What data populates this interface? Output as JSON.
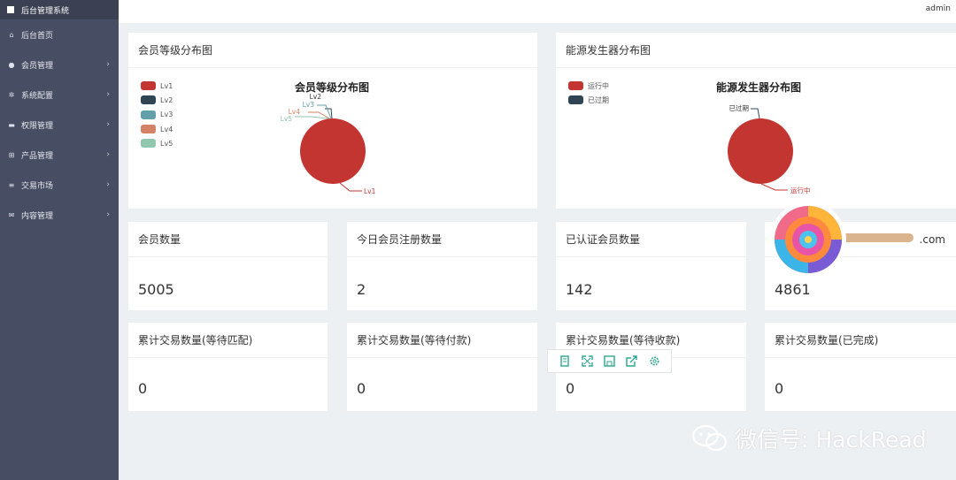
{
  "sidebar": {
    "brand": "后台管理系统",
    "items": [
      {
        "label": "后台首页",
        "icon": "home-icon",
        "has_children": false
      },
      {
        "label": "会员管理",
        "icon": "user-icon",
        "has_children": true
      },
      {
        "label": "系统配置",
        "icon": "gears-icon",
        "has_children": true
      },
      {
        "label": "权限管理",
        "icon": "card-icon",
        "has_children": true
      },
      {
        "label": "产品管理",
        "icon": "windows-icon",
        "has_children": true
      },
      {
        "label": "交易市场",
        "icon": "list-icon",
        "has_children": true
      },
      {
        "label": "内容管理",
        "icon": "mail-icon",
        "has_children": true
      }
    ]
  },
  "topbar": {
    "user": "admin"
  },
  "panels": {
    "member_chart": {
      "header": "会员等级分布图",
      "chart_data": {
        "type": "pie",
        "title": "会员等级分布图",
        "legend_position": "top-left",
        "categories": [
          "Lv1",
          "Lv2",
          "Lv3",
          "Lv4",
          "Lv5"
        ],
        "colors": [
          "#c23531",
          "#2f4554",
          "#61a0a8",
          "#d48265",
          "#91c7ae"
        ],
        "values": [
          5005,
          0,
          0,
          0,
          0
        ]
      }
    },
    "energy_chart": {
      "header": "能源发生器分布图",
      "chart_data": {
        "type": "pie",
        "title": "能源发生器分布图",
        "legend_position": "top-left",
        "categories": [
          "运行中",
          "已过期"
        ],
        "colors": [
          "#c23531",
          "#2f4554"
        ],
        "values": [
          100,
          0
        ]
      }
    }
  },
  "stats_row1": [
    {
      "label": "会员数量",
      "value": "5005"
    },
    {
      "label": "今日会员注册数量",
      "value": "2"
    },
    {
      "label": "已认证会员数量",
      "value": "142"
    },
    {
      "label": ".com",
      "value": "4861"
    }
  ],
  "stats_row2": [
    {
      "label": "累计交易数量(等待匹配)",
      "value": "0"
    },
    {
      "label": "累计交易数量(等待付款)",
      "value": "0"
    },
    {
      "label": "累计交易数量(等待收款)",
      "value": "0"
    },
    {
      "label": "累计交易数量(已完成)",
      "value": "0"
    }
  ],
  "toolbox": [
    "data-view-icon",
    "zoom-icon",
    "save-icon",
    "share-icon",
    "settings-icon"
  ],
  "watermark": "微信号: HackRead",
  "accent_color": "#2ea58f"
}
